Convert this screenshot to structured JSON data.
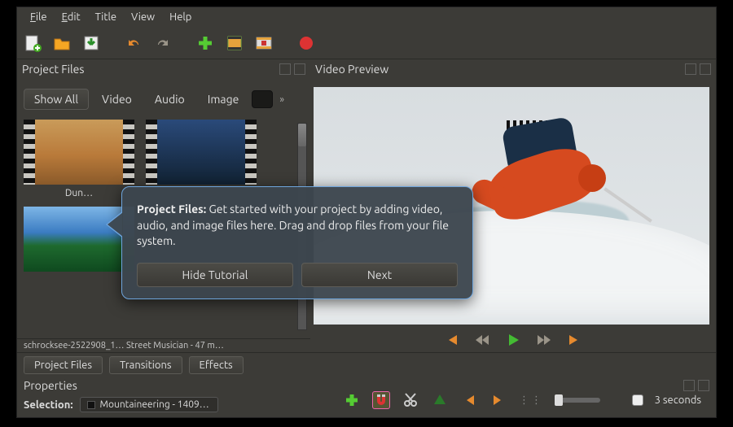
{
  "menu": {
    "items": [
      "File",
      "Edit",
      "Title",
      "View",
      "Help"
    ]
  },
  "toolbar": {
    "icons": [
      "new-file",
      "open-file",
      "save-file",
      "undo",
      "redo",
      "add",
      "filmstrip",
      "film-cut",
      "record"
    ]
  },
  "project_files": {
    "title": "Project Files",
    "filter_tabs": [
      "Show All",
      "Video",
      "Audio",
      "Image"
    ],
    "thumbs": [
      {
        "label": "Dun…",
        "kind": "video",
        "style": "desert"
      },
      {
        "label": "",
        "kind": "video",
        "style": "blue"
      },
      {
        "label": "",
        "kind": "image",
        "style": "lake"
      }
    ],
    "truncated_row": "schrocksee-2522908_1… Street Musician - 47 m…"
  },
  "preview": {
    "title": "Video Preview"
  },
  "playback": {
    "icons": [
      "prev",
      "rewind",
      "play",
      "forward",
      "next"
    ]
  },
  "bottom_tabs": [
    "Project Files",
    "Transitions",
    "Effects"
  ],
  "properties": {
    "title": "Properties",
    "selection_label": "Selection:",
    "selection_value": "Mountaineering - 1409…"
  },
  "bottom_tools": {
    "icons": [
      "add",
      "magnet",
      "cut",
      "marker",
      "prev",
      "next"
    ],
    "seconds_label": "3 seconds"
  },
  "tutorial": {
    "heading": "Project Files:",
    "body": "Get started with your project by adding video, audio, and image files here. Drag and drop files from your file system.",
    "hide_label": "Hide Tutorial",
    "next_label": "Next"
  }
}
